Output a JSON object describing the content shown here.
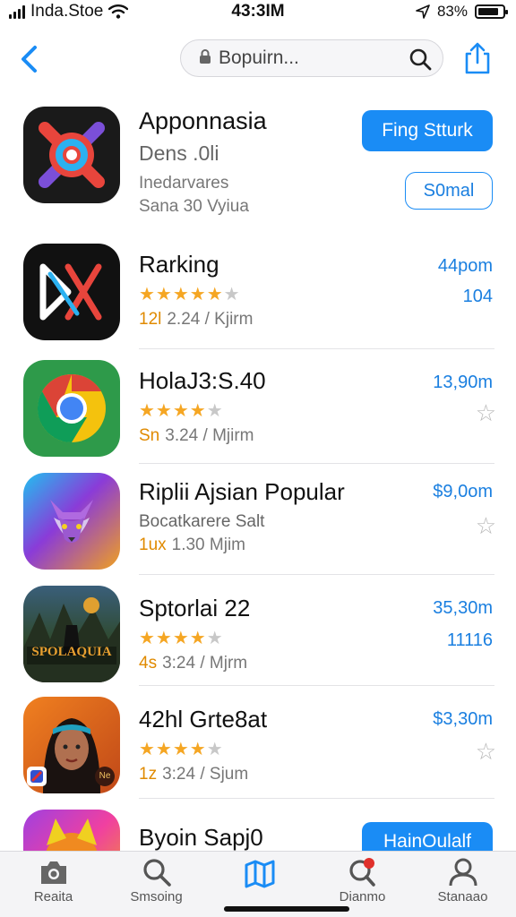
{
  "status_bar": {
    "carrier": "Inda.Stoe",
    "time": "43:3IM",
    "battery": "83%",
    "battery_level": 0.83
  },
  "nav": {
    "back_icon": "chevron-left-icon",
    "search_placeholder": "Bopuirn...",
    "search_icon": "search-icon",
    "share_icon": "share-icon"
  },
  "featured": {
    "title": "Apponnasia",
    "subtitle": "Dens .0li",
    "meta1": "Inedarvares",
    "meta2": "Sana 30  Vyiua",
    "primary_button": "Fing Stturk",
    "secondary_button": "S0mal"
  },
  "apps": [
    {
      "title": "Rarking",
      "meta_accent": "12l",
      "meta": "2.24 / Kjirm",
      "rating": 5,
      "price": "44pom",
      "rank": "104"
    },
    {
      "title": "HolaJ3:S.40",
      "meta_accent": "Sn",
      "meta": "3.24 / Mjirm",
      "rating": 4,
      "price": "13,90m"
    },
    {
      "title": "Riplii Ajsian Popular",
      "subtitle": "Bocatkarere Salt",
      "meta_accent": "1ux",
      "meta": "1.30  Mjim",
      "price": "$9,0om"
    },
    {
      "title": "Sptorlai 22",
      "meta_accent": "4s",
      "meta": "3:24 / Mjrm",
      "rating": 4,
      "price": "35,30m",
      "rank": "11116",
      "icon_text": "SPOLAQUIA"
    },
    {
      "title": "42hl Grte8at",
      "meta_accent": "1z",
      "meta": "3:24 / Sjum",
      "rating": 4,
      "price": "$3,30m",
      "icon_badge": "Ne"
    },
    {
      "title": "Byoin Sapj0",
      "primary_button": "HainOulalf"
    }
  ],
  "tabs": [
    {
      "label": "Reaita",
      "icon": "camera-icon"
    },
    {
      "label": "Smsoing",
      "icon": "search-icon"
    },
    {
      "label": "",
      "icon": "map-icon"
    },
    {
      "label": "Dianmo",
      "icon": "notification-icon"
    },
    {
      "label": "Stanaao",
      "icon": "person-icon"
    }
  ],
  "colors": {
    "accent": "#1a8cf5",
    "star": "#f5a623",
    "badge": "#e0302b"
  }
}
